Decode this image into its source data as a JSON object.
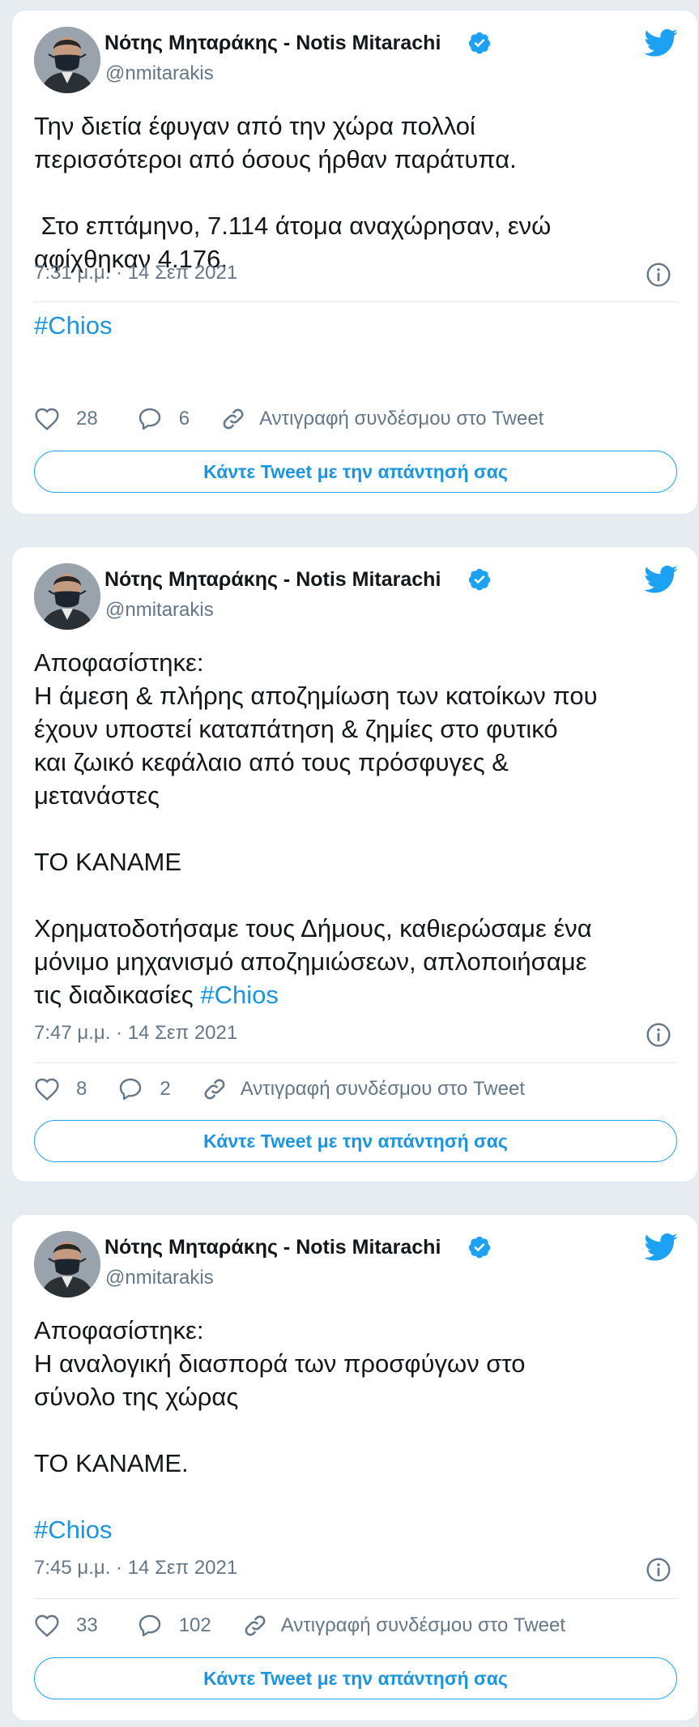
{
  "colors": {
    "background": "#e6ecf0",
    "card": "#ffffff",
    "text_primary": "#14171a",
    "text_secondary": "#657786",
    "accent": "#1b95e0",
    "verified": "#1da1f2"
  },
  "tweets": [
    {
      "author_name": "Νότης Μηταράκης - Notis Mitarachi",
      "author_handle": "@nmitarakis",
      "verified_icon": "verified-badge-icon",
      "brand_icon": "twitter-bird-icon",
      "text_lines": "Την διετία έφυγαν από την χώρα πολλοί\nπερισσότεροι από όσους ήρθαν παράτυπα.\n\n Στο επτάμηνο, 7.114 άτομα αναχώρησαν, ενώ\nαφίχθηκαν 4.176.\n\n",
      "hashtag": "#Chios",
      "timestamp": "7:31 μ.μ. · 14 Σεπ 2021",
      "likes": "28",
      "replies": "6",
      "copy_link_label": "Αντιγραφή συνδέσμου στο Tweet",
      "reply_button_label": "Κάντε Tweet με την απάντησή σας"
    },
    {
      "author_name": "Νότης Μηταράκης - Notis Mitarachi",
      "author_handle": "@nmitarakis",
      "verified_icon": "verified-badge-icon",
      "brand_icon": "twitter-bird-icon",
      "text_lines": "Αποφασίστηκε:\nΗ άμεση & πλήρης αποζημίωση των κατοίκων που\nέχουν υποστεί καταπάτηση & ζημίες στο φυτικό\nκαι ζωικό κεφάλαιο από τους πρόσφυγες &\nμετανάστες\n\nΤΟ ΚΑΝΑΜΕ\n\nΧρηματοδοτήσαμε τους Δήμους, καθιερώσαμε ένα\nμόνιμο μηχανισμό αποζημιώσεων, απλοποιήσαμε\nτις διαδικασίες ",
      "hashtag": "#Chios",
      "timestamp": "7:47 μ.μ. · 14 Σεπ 2021",
      "likes": "8",
      "replies": "2",
      "copy_link_label": "Αντιγραφή συνδέσμου στο Tweet",
      "reply_button_label": "Κάντε Tweet με την απάντησή σας"
    },
    {
      "author_name": "Νότης Μηταράκης - Notis Mitarachi",
      "author_handle": "@nmitarakis",
      "verified_icon": "verified-badge-icon",
      "brand_icon": "twitter-bird-icon",
      "text_lines": "Αποφασίστηκε:\nΗ αναλογική διασπορά των προσφύγων στο\nσύνολο της χώρας\n\nΤΟ ΚΑΝΑΜΕ.\n\n",
      "hashtag": "#Chios",
      "timestamp": "7:45 μ.μ. · 14 Σεπ 2021",
      "likes": "33",
      "replies": "102",
      "copy_link_label": "Αντιγραφή συνδέσμου στο Tweet",
      "reply_button_label": "Κάντε Tweet με την απάντησή σας"
    }
  ]
}
